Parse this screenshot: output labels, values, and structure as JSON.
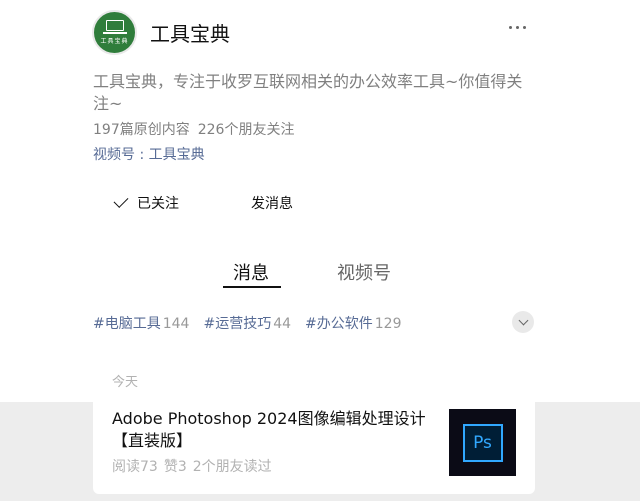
{
  "account": {
    "name": "工具宝典",
    "avatar_text": "工具宝典",
    "description": "工具宝典，专注于收罗互联网相关的办公效率工具~你值得关注~",
    "articles": "197篇原创内容",
    "friends": "226个朋友关注",
    "channel": "视频号 : 工具宝典"
  },
  "actions": {
    "follow": "已关注",
    "message": "发消息"
  },
  "tabs": [
    {
      "label": "消息",
      "active": true
    },
    {
      "label": "视频号",
      "active": false
    }
  ],
  "tags": [
    {
      "label": "#电脑工具",
      "count": "144"
    },
    {
      "label": "#运营技巧",
      "count": "44"
    },
    {
      "label": "#办公软件",
      "count": "129"
    }
  ],
  "feed": {
    "date": "今天",
    "article": {
      "title": "Adobe Photoshop 2024图像编辑处理设计【直装版】",
      "reads": "阅读73",
      "likes": "赞3",
      "friends_read": "2个朋友读过",
      "thumb_text": "Ps"
    }
  },
  "colors": {
    "link": "#576b95",
    "avatar": "#2f7d3b",
    "ps_blue": "#31a8ff"
  }
}
